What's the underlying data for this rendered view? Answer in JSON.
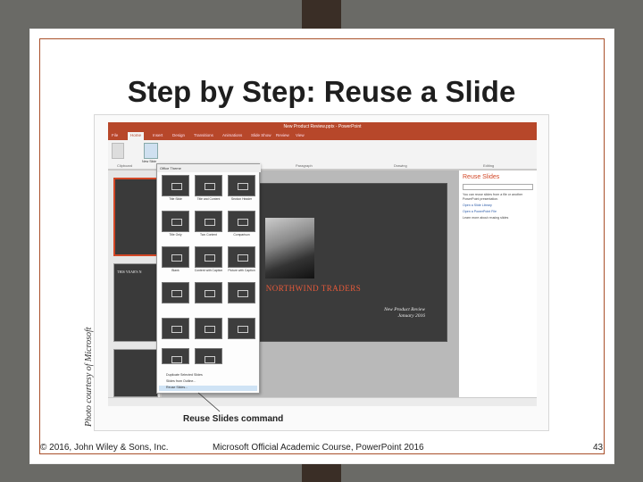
{
  "slide": {
    "title": "Step by Step: Reuse a Slide",
    "callout": "Reuse Slides command",
    "side_caption": "Photo courtesy of Microsoft",
    "footer_left": "© 2016, John Wiley & Sons, Inc.",
    "footer_center": "Microsoft Official Academic Course, PowerPoint 2016",
    "page_number": "43"
  },
  "ppt": {
    "window_title": "New Product Review.pptx - PowerPoint",
    "tabs": [
      "File",
      "Home",
      "Insert",
      "Design",
      "Transitions",
      "Animations",
      "Slide Show",
      "Review",
      "View"
    ],
    "active_tab": "Home",
    "ribbon_groups": [
      "Clipboard",
      "Paragraph",
      "Drawing",
      "Editing"
    ],
    "new_slide_label": "New Slide",
    "slide_brand": "NORTHWIND TRADERS",
    "slide_subtitle_1": "New Product Review",
    "slide_subtitle_2": "January 2016",
    "thumb_heading": "THIS YEAR'S N",
    "pane": {
      "title": "Reuse Slides",
      "text": "You can reuse slides from a file or another PowerPoint presentation.",
      "links": [
        "Open a Slide Library",
        "Open a PowerPoint File",
        "Learn more about reusing slides"
      ]
    },
    "gallery": {
      "header": "Office Theme",
      "layouts": [
        "Title Slide",
        "Title and Content",
        "Section Header",
        "Title Only",
        "Two Content",
        "Comparison",
        "Blank",
        "Content with Caption",
        "Picture with Caption"
      ],
      "menu": [
        "Duplicate Selected Slides",
        "Slides from Outline...",
        "Reuse Slides..."
      ]
    }
  }
}
